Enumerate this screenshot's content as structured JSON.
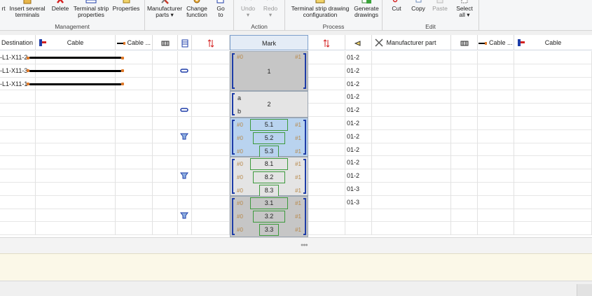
{
  "ribbon": {
    "groups": [
      {
        "name": "Management"
      },
      {
        "name": "Action"
      },
      {
        "name": "Process"
      },
      {
        "name": "Edit"
      }
    ],
    "buttons": {
      "sort": "rt",
      "insert_several": [
        "Insert several",
        "terminals"
      ],
      "delete": "Delete",
      "strip_props": [
        "Terminal strip",
        "properties"
      ],
      "properties": "Properties",
      "manufacturer_parts": [
        "Manufacturer",
        "parts ▾"
      ],
      "change_function": [
        "Change",
        "function"
      ],
      "go_to": [
        "Go",
        "to"
      ],
      "undo": [
        "Undo",
        "▾"
      ],
      "redo": [
        "Redo",
        "▾"
      ],
      "strip_drawing": [
        "Terminal strip drawing",
        "configuration"
      ],
      "generate": [
        "Generate",
        "drawings"
      ],
      "cut": "Cut",
      "copy": "Copy",
      "paste": "Paste",
      "select_all": [
        "Select",
        "all ▾"
      ]
    }
  },
  "grid": {
    "headers": {
      "destination": "Destination",
      "cable": "Cable",
      "cable_dots": "Cable ...",
      "mark": "Mark",
      "manufacturer_part": "Manufacturer part",
      "cable_dots_2": "Cable ...",
      "cable_2": "Cable"
    },
    "rows": [
      {
        "dest": "-L1-X11-2",
        "code": "01-2"
      },
      {
        "dest": "-L1-X11-3",
        "code": "01-2"
      },
      {
        "dest": "-L1-X11-1",
        "code": "01-2"
      },
      {
        "dest": "",
        "code": "01-2"
      },
      {
        "dest": "",
        "code": "01-2"
      },
      {
        "dest": "",
        "code": "01-2"
      },
      {
        "dest": "",
        "code": "01-2"
      },
      {
        "dest": "",
        "code": "01-2"
      },
      {
        "dest": "",
        "code": "01-2"
      },
      {
        "dest": "",
        "code": "01-2"
      },
      {
        "dest": "",
        "code": "01-3"
      },
      {
        "dest": "",
        "code": "01-3"
      },
      {
        "dest": "",
        "code": ""
      },
      {
        "dest": "",
        "code": ""
      }
    ],
    "marks": {
      "block1": {
        "label": "1",
        "tag_l": "#0",
        "tag_r": "#1"
      },
      "block2": {
        "label": "2",
        "a": "a",
        "b": "b"
      },
      "block5": {
        "items": [
          "5.1",
          "5.2",
          "5.3"
        ],
        "tag_l": "#0",
        "tag_r": "#1"
      },
      "block8": {
        "items": [
          "8.1",
          "8.2",
          "8.3"
        ],
        "tag_l": "#0",
        "tag_r": "#1"
      },
      "block3": {
        "items": [
          "3.1",
          "3.2",
          "3.3"
        ],
        "tag_l": "#0",
        "tag_r": "#1"
      }
    }
  },
  "colors": {
    "accent_blue": "#1e3da8",
    "mark_grey": "#c6c6c6",
    "mark_blue": "#b9d3ef",
    "mark_green_border": "#3d9a3d",
    "tag_color": "#b8894a"
  }
}
